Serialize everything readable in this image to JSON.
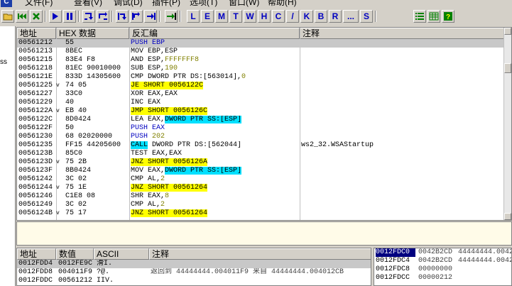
{
  "menu": {
    "app_icon": "C",
    "items": [
      "文件(F)",
      "查看(V)",
      "调试(D)",
      "插件(P)",
      "选项(T)",
      "窗口(W)",
      "帮助(H)"
    ]
  },
  "toolbar": {
    "icons": [
      "open-icon",
      "restart-icon",
      "close-icon",
      "run-icon",
      "pause-icon",
      "step-into-icon",
      "step-over-icon",
      "trace-into-icon",
      "trace-over-icon",
      "execute-till-return-icon",
      "goto-icon"
    ],
    "letters": [
      "L",
      "E",
      "M",
      "T",
      "W",
      "H",
      "C",
      "/",
      "K",
      "B",
      "R",
      "...",
      "S"
    ],
    "right_icons": [
      "list-icon",
      "grid-icon",
      "help-icon"
    ]
  },
  "left_strip": {
    "text": "ss"
  },
  "cpu": {
    "headers": {
      "address": "地址",
      "hex": "HEX 数据",
      "disasm": "反汇编",
      "comment": "注释"
    },
    "rows": [
      {
        "addr": "00561212",
        "arrow": "",
        "hex": "55",
        "dis": [
          {
            "t": "PUSH EBP",
            "c": "kw-blue"
          }
        ],
        "cmt": "",
        "selected": true
      },
      {
        "addr": "00561213",
        "arrow": "",
        "hex": "8BEC",
        "dis": [
          {
            "t": "MOV EBP,ESP"
          }
        ],
        "cmt": ""
      },
      {
        "addr": "00561215",
        "arrow": "",
        "hex": "83E4 F8",
        "dis": [
          {
            "t": "AND ESP,"
          },
          {
            "t": "FFFFFFF8",
            "c": "num-olive"
          }
        ],
        "cmt": ""
      },
      {
        "addr": "00561218",
        "arrow": "",
        "hex": "81EC 90010000",
        "dis": [
          {
            "t": "SUB ESP,"
          },
          {
            "t": "190",
            "c": "num-olive"
          }
        ],
        "cmt": ""
      },
      {
        "addr": "0056121E",
        "arrow": "",
        "hex": "833D 14305600",
        "dis": [
          {
            "t": "CMP DWORD PTR DS:[563014],"
          },
          {
            "t": "0",
            "c": "num-olive"
          }
        ],
        "cmt": ""
      },
      {
        "addr": "00561225",
        "arrow": "v",
        "hex": "74 05",
        "dis": [
          {
            "t": "JE SHORT 0056122C",
            "c": "hl-yellow"
          }
        ],
        "cmt": ""
      },
      {
        "addr": "00561227",
        "arrow": "",
        "hex": "33C0",
        "dis": [
          {
            "t": "XOR EAX,EAX"
          }
        ],
        "cmt": ""
      },
      {
        "addr": "00561229",
        "arrow": "",
        "hex": "40",
        "dis": [
          {
            "t": "INC EAX"
          }
        ],
        "cmt": ""
      },
      {
        "addr": "0056122A",
        "arrow": "v",
        "hex": "EB 40",
        "dis": [
          {
            "t": "JMP SHORT 0056126C",
            "c": "hl-yellow"
          }
        ],
        "cmt": ""
      },
      {
        "addr": "0056122C",
        "arrow": "",
        "hex": "8D0424",
        "dis": [
          {
            "t": "LEA EAX,"
          },
          {
            "t": "DWORD PTR SS:[ESP]",
            "c": "hl-cyan"
          }
        ],
        "cmt": ""
      },
      {
        "addr": "0056122F",
        "arrow": "",
        "hex": "50",
        "dis": [
          {
            "t": "PUSH EAX",
            "c": "kw-blue"
          }
        ],
        "cmt": ""
      },
      {
        "addr": "00561230",
        "arrow": "",
        "hex": "68 02020000",
        "dis": [
          {
            "t": "PUSH ",
            "c": "kw-blue"
          },
          {
            "t": "202",
            "c": "num-olive"
          }
        ],
        "cmt": ""
      },
      {
        "addr": "00561235",
        "arrow": "",
        "hex": "FF15 44205600",
        "dis": [
          {
            "t": "CALL",
            "c": "hl-cyan"
          },
          {
            "t": " DWORD PTR DS:[562044]"
          }
        ],
        "cmt": "ws2_32.WSAStartup"
      },
      {
        "addr": "0056123B",
        "arrow": "",
        "hex": "85C0",
        "dis": [
          {
            "t": "TEST EAX,EAX"
          }
        ],
        "cmt": ""
      },
      {
        "addr": "0056123D",
        "arrow": "v",
        "hex": "75 2B",
        "dis": [
          {
            "t": "JNZ SHORT 0056126A",
            "c": "hl-yellow"
          }
        ],
        "cmt": ""
      },
      {
        "addr": "0056123F",
        "arrow": "",
        "hex": "8B0424",
        "dis": [
          {
            "t": "MOV EAX,"
          },
          {
            "t": "DWORD PTR SS:[ESP]",
            "c": "hl-cyan"
          }
        ],
        "cmt": ""
      },
      {
        "addr": "00561242",
        "arrow": "",
        "hex": "3C 02",
        "dis": [
          {
            "t": "CMP AL,"
          },
          {
            "t": "2",
            "c": "num-olive"
          }
        ],
        "cmt": ""
      },
      {
        "addr": "00561244",
        "arrow": "v",
        "hex": "75 1E",
        "dis": [
          {
            "t": "JNZ SHORT 00561264",
            "c": "hl-yellow"
          }
        ],
        "cmt": ""
      },
      {
        "addr": "00561246",
        "arrow": "",
        "hex": "C1E8 08",
        "dis": [
          {
            "t": "SHR EAX,"
          },
          {
            "t": "8",
            "c": "num-olive"
          }
        ],
        "cmt": ""
      },
      {
        "addr": "00561249",
        "arrow": "",
        "hex": "3C 02",
        "dis": [
          {
            "t": "CMP AL,"
          },
          {
            "t": "2",
            "c": "num-olive"
          }
        ],
        "cmt": ""
      },
      {
        "addr": "0056124B",
        "arrow": "v",
        "hex": "75 17",
        "dis": [
          {
            "t": "JNZ SHORT 00561264",
            "c": "hl-yellow"
          }
        ],
        "cmt": ""
      }
    ]
  },
  "dump": {
    "headers": {
      "address": "地址",
      "value": "数值",
      "ascii": "ASCII",
      "comment": "注释"
    },
    "rows": [
      {
        "addr": "0012FDD4",
        "val": "0012FE9C",
        "asc": "滑I.",
        "cmt": "",
        "selected": true
      },
      {
        "addr": "0012FDD8",
        "val": "004011F9",
        "asc": "?@.",
        "cmt": "返回到 44444444.004011F9 来自 44444444.004012CB"
      },
      {
        "addr": "0012FDDC",
        "val": "00561212",
        "asc": "IIV.",
        "cmt": ""
      }
    ]
  },
  "stack": {
    "rows": [
      {
        "addr": "0012FDC0",
        "val": "0042B2CD",
        "cmt": "44444444.0042",
        "selected": true
      },
      {
        "addr": "0012FDC4",
        "val": "0042B2CD",
        "cmt": "44444444.0042"
      },
      {
        "addr": "0012FDC8",
        "val": "00000000",
        "cmt": ""
      },
      {
        "addr": "0012FDCC",
        "val": "00000212",
        "cmt": ""
      }
    ]
  }
}
